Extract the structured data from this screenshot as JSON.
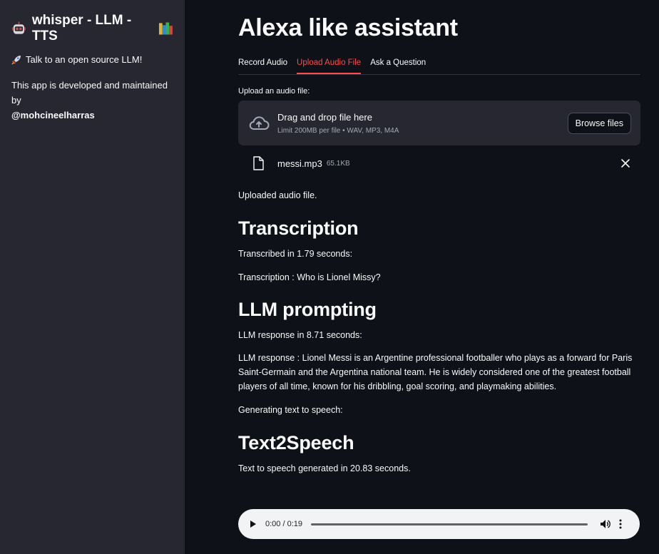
{
  "sidebar": {
    "title": "whisper - LLM - TTS",
    "tagline": "Talk to an open source LLM!",
    "dev_text": "This app is developed and maintained by",
    "author": "@mohcineelharras"
  },
  "main": {
    "title": "Alexa like assistant",
    "tabs": [
      {
        "label": "Record Audio",
        "active": false
      },
      {
        "label": "Upload Audio File",
        "active": true
      },
      {
        "label": "Ask a Question",
        "active": false
      }
    ],
    "upload": {
      "label": "Upload an audio file:",
      "drop_text": "Drag and drop file here",
      "limit_text": "Limit 200MB per file • WAV, MP3, M4A",
      "browse_label": "Browse files",
      "file_name": "messi.mp3",
      "file_size": "65.1KB"
    },
    "uploaded_text": "Uploaded audio file.",
    "transcription": {
      "heading": "Transcription",
      "time_text": "Transcribed in 1.79 seconds:",
      "result_text": "Transcription : Who is Lionel Missy?"
    },
    "llm": {
      "heading": "LLM prompting",
      "time_text": "LLM response in 8.71 seconds:",
      "response_text": "LLM response : Lionel Messi is an Argentine professional footballer who plays as a forward for Paris Saint-Germain and the Argentina national team. He is widely considered one of the greatest football players of all time, known for his dribbling, goal scoring, and playmaking abilities.",
      "tts_status": "Generating text to speech:"
    },
    "tts": {
      "heading": "Text2Speech",
      "time_text": "Text to speech generated in 20.83 seconds.",
      "player_time": "0:00 / 0:19"
    }
  },
  "colors": {
    "background": "#0e1117",
    "sidebar": "#262730",
    "accent": "#ff4b4b"
  },
  "icons": [
    "robot-icon",
    "books-icon",
    "rocket-icon",
    "cloud-upload-icon",
    "file-icon",
    "close-icon",
    "play-icon",
    "volume-icon",
    "more-vert-icon"
  ]
}
